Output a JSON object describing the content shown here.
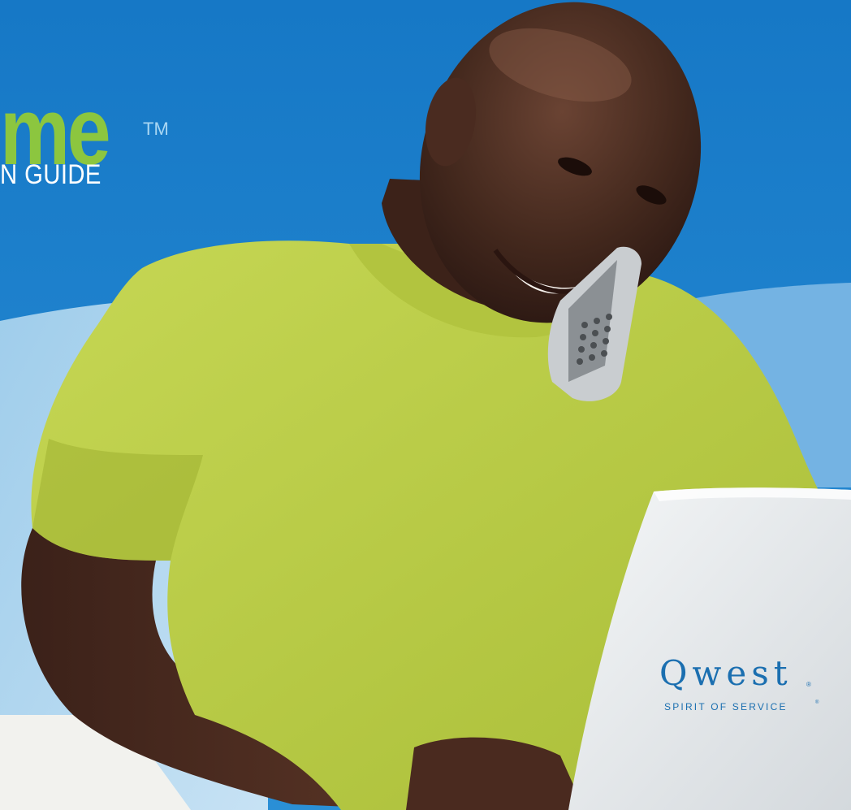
{
  "cover": {
    "title": "me",
    "trademark": "TM",
    "subtitle": "N GUIDE"
  },
  "brand": {
    "name": "Qwest",
    "registered": "®",
    "tagline": "SPIRIT OF SERVICE",
    "tagline_registered": "®"
  },
  "colors": {
    "background_blue": "#1a7ec9",
    "wave_light_blue": "#9fcdeb",
    "title_green": "#8cc63f",
    "shirt_green": "#bcd04a",
    "brand_blue": "#1b6fb0",
    "laptop_silver": "#e9ecef"
  }
}
